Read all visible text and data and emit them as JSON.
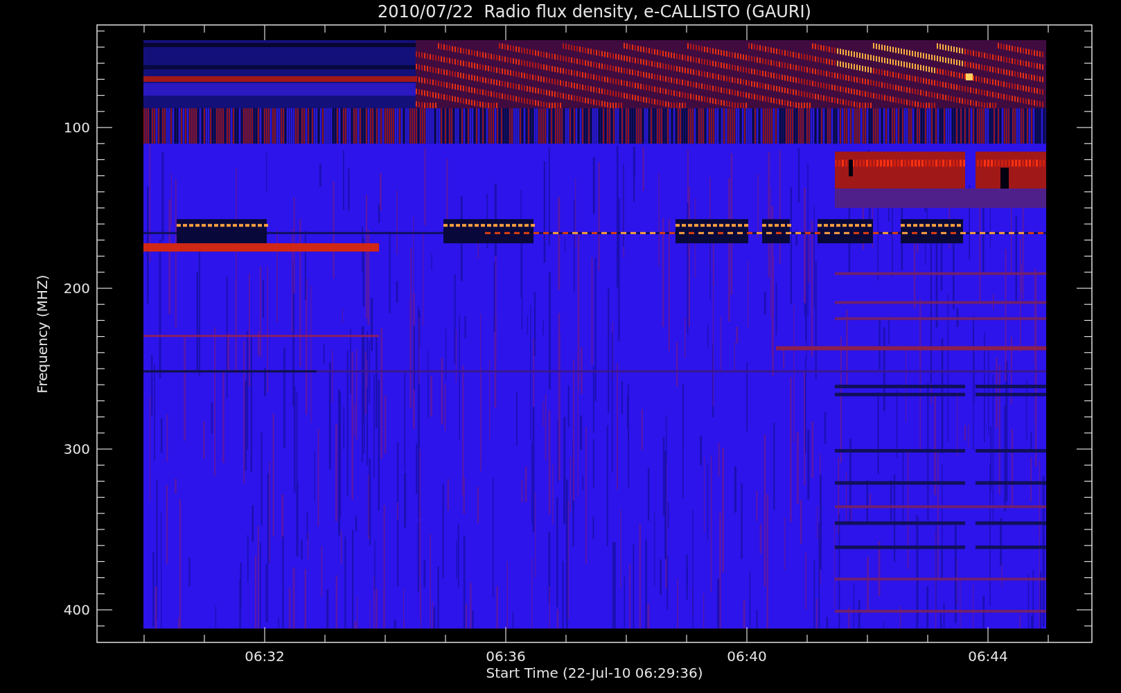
{
  "plot": {
    "title": "2010/07/22  Radio flux density, e-CALLISTO (GAURI)",
    "xlabel": "Start Time (22-Jul-10 06:29:36)",
    "ylabel": "Frequency (MHZ)",
    "xticks": [
      "06:32",
      "06:36",
      "06:40",
      "06:44"
    ],
    "yticks": [
      "100",
      "200",
      "300",
      "400"
    ]
  }
}
